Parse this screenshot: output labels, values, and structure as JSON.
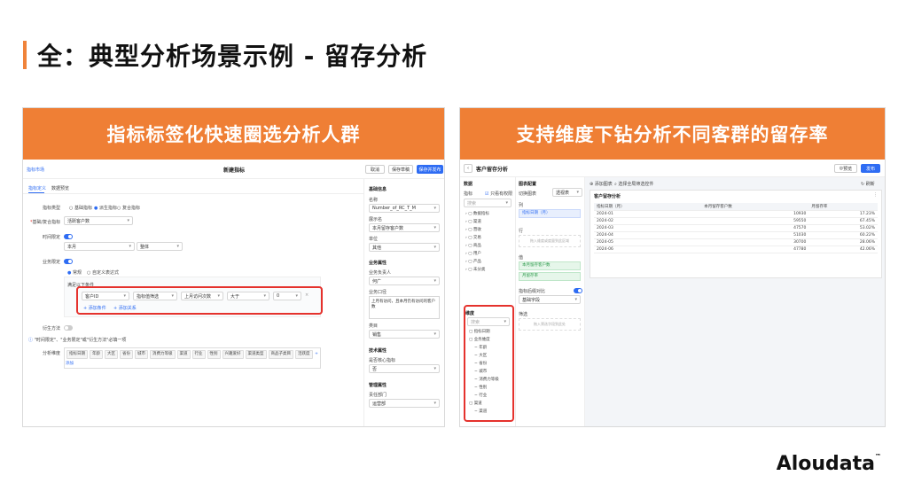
{
  "slide": {
    "title": "全：典型分析场景示例 - 留存分析",
    "brand": "Aloudata",
    "brand_tm": "™"
  },
  "left_panel": {
    "banner": "指标标签化快速圈选分析人群",
    "header": {
      "back": "指标市场",
      "title": "新建指标",
      "cancel": "取消",
      "save_draft": "保存草稿",
      "save_publish": "保存并发布"
    },
    "tabs": [
      "指标定义",
      "数据预览"
    ],
    "form": {
      "type_label": "指标类型",
      "type_options": [
        "基础指标",
        "派生指标",
        "复合指标"
      ],
      "base_label": "基础/复合指标",
      "base_value": "活跃客户数",
      "time_label": "时间限定",
      "time_value1": "本月",
      "time_value2": "整体",
      "biz_label": "业务限定",
      "biz_options": [
        "常规",
        "自定义表达式"
      ],
      "cond_title": "满足以下条件",
      "cond_fields": [
        "客户ID",
        "指标值筛选",
        "上月访问次数",
        "大于",
        "0"
      ],
      "add_cond": "添加条件",
      "add_group": "添加关系",
      "derive_label": "衍生方法",
      "note": "\"时间限定\"、\"业务限定\"或\"衍生方法\"必填一项",
      "dim_label": "分析维度",
      "dims": [
        "指标日期",
        "年龄",
        "大区",
        "省份",
        "城市",
        "消费力等级",
        "渠道",
        "行业",
        "性别",
        "兴趣爱好",
        "渠道类型",
        "商品子类目",
        "活跃度"
      ],
      "add_dim": "添加"
    },
    "side": {
      "basic_title": "基础信息",
      "name_label": "名称",
      "name_value": "Number_of_RC_T_M",
      "display_label": "展示名",
      "display_value": "本月留存客户数",
      "unit_label": "单位",
      "unit_value": "其他",
      "biz_title": "业务属性",
      "owner_label": "业务负责人",
      "owner_value": "何广",
      "caliber_label": "业务口径",
      "caliber_value": "上月有访问，且本月仍有访问的客户数",
      "cat_label": "类目",
      "cat_value": "销售",
      "tech_title": "技术属性",
      "core_label": "是否核心指标",
      "core_value": "否",
      "mgmt_title": "管理属性",
      "dept_label": "责任部门",
      "dept_value": "运营部"
    }
  },
  "right_panel": {
    "banner": "支持维度下钻分析不同客群的留存率",
    "header": {
      "back": "‹",
      "title": "客户留存分析",
      "preview": "预览",
      "publish": "发布"
    },
    "data_col": {
      "title": "数据",
      "metric_label": "指标",
      "only_fav": "只看有权限",
      "search": "搜索",
      "folders": [
        "数据指标",
        "渠道",
        "营收",
        "交易",
        "商品",
        "用户",
        "产品",
        "未分类"
      ]
    },
    "config_col": {
      "title": "图表配置",
      "chart_type_label": "切换图表",
      "chart_type": "透视表",
      "col_label": "列",
      "col_item": "指标日期（月）",
      "row_label": "行",
      "row_placeholder": "拖入维度或度量到此区域",
      "value_label": "值",
      "values": [
        "本月留存客户数",
        "月留存率"
      ],
      "drill_label": "指标后缀对比",
      "drill_value": "基础字段",
      "filter_label": "筛选",
      "filter_placeholder": "拖入筛选字段到此处"
    },
    "dim_tree": {
      "title": "维度",
      "search": "搜索",
      "items": [
        "指标日期",
        "业务维度",
        "年龄",
        "大区",
        "省份",
        "城市",
        "消费力等级",
        "性别",
        "行业",
        "渠道",
        "渠道"
      ]
    },
    "canvas": {
      "toolbar": [
        "添加图表",
        "选择全局筛选控件"
      ],
      "hint": "刷新",
      "card_title": "客户留存分析",
      "columns": [
        "指标日期（月）",
        "本月留存客户数",
        "月留存率"
      ],
      "rows": [
        [
          "2024-01",
          "10930",
          "17.23%"
        ],
        [
          "2024-02",
          "59550",
          "67.45%"
        ],
        [
          "2024-03",
          "47570",
          "53.02%"
        ],
        [
          "2024-04",
          "51030",
          "60.22%"
        ],
        [
          "2024-05",
          "30700",
          "28.06%"
        ],
        [
          "2024-06",
          "47780",
          "42.06%"
        ]
      ]
    }
  }
}
